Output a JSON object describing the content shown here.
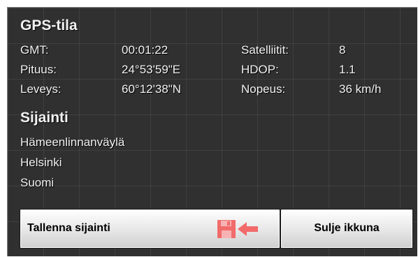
{
  "gps": {
    "title": "GPS-tila",
    "rows": [
      {
        "label": "GMT:",
        "value": "00:01:22",
        "label2": "Satelliitit:",
        "value2": "8"
      },
      {
        "label": "Pituus:",
        "value": "24°53'59\"E",
        "label2": "HDOP:",
        "value2": "1.1"
      },
      {
        "label": "Leveys:",
        "value": "60°12'38\"N",
        "label2": "Nopeus:",
        "value2": "36 km/h"
      }
    ]
  },
  "location": {
    "title": "Sijainti",
    "lines": [
      "Hämeenlinnanväylä",
      "Helsinki",
      "Suomi"
    ]
  },
  "buttons": {
    "save_label": "Tallenna sijainti",
    "close_label": "Sulje ikkuna"
  },
  "icons": {
    "save": "save-location-icon",
    "save_color": "#f26b6b"
  }
}
